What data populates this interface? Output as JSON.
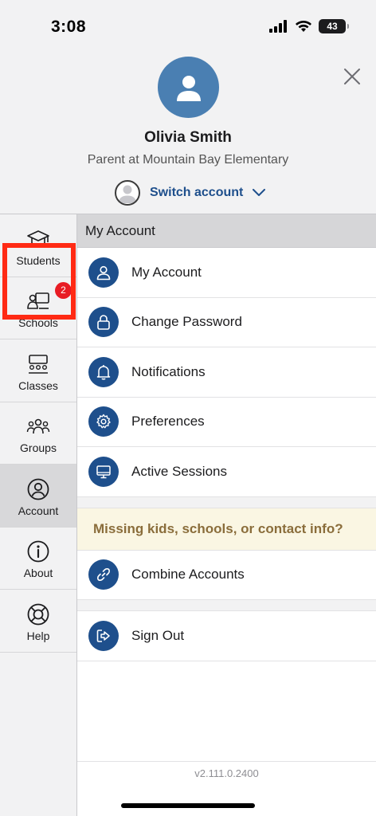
{
  "status_bar": {
    "time": "3:08",
    "battery": "43"
  },
  "profile": {
    "name": "Olivia Smith",
    "role": "Parent at Mountain Bay Elementary",
    "switch_account_label": "Switch account"
  },
  "sidebar": {
    "items": [
      {
        "label": "Students",
        "icon": "graduation-cap-icon"
      },
      {
        "label": "Schools",
        "icon": "school-icon",
        "badge": "2"
      },
      {
        "label": "Classes",
        "icon": "classroom-icon"
      },
      {
        "label": "Groups",
        "icon": "groups-icon"
      },
      {
        "label": "Account",
        "icon": "account-icon",
        "active": true
      },
      {
        "label": "About",
        "icon": "info-icon"
      },
      {
        "label": "Help",
        "icon": "lifebuoy-icon"
      }
    ]
  },
  "main": {
    "section_title": "My Account",
    "menu": [
      {
        "label": "My Account",
        "icon": "person-icon"
      },
      {
        "label": "Change Password",
        "icon": "lock-icon"
      },
      {
        "label": "Notifications",
        "icon": "bell-icon"
      },
      {
        "label": "Preferences",
        "icon": "gear-icon"
      },
      {
        "label": "Active Sessions",
        "icon": "monitor-icon"
      }
    ],
    "notice": "Missing kids, schools, or contact info?",
    "combine": {
      "label": "Combine Accounts",
      "icon": "link-icon"
    },
    "signout": {
      "label": "Sign Out",
      "icon": "sign-out-icon"
    },
    "version": "v2.111.0.2400"
  },
  "colors": {
    "accent": "#1e4f8c",
    "avatar": "#4a7fb2",
    "badge": "#e81c24",
    "highlight": "#ff2a14",
    "notice_text": "#8a6d3b"
  }
}
